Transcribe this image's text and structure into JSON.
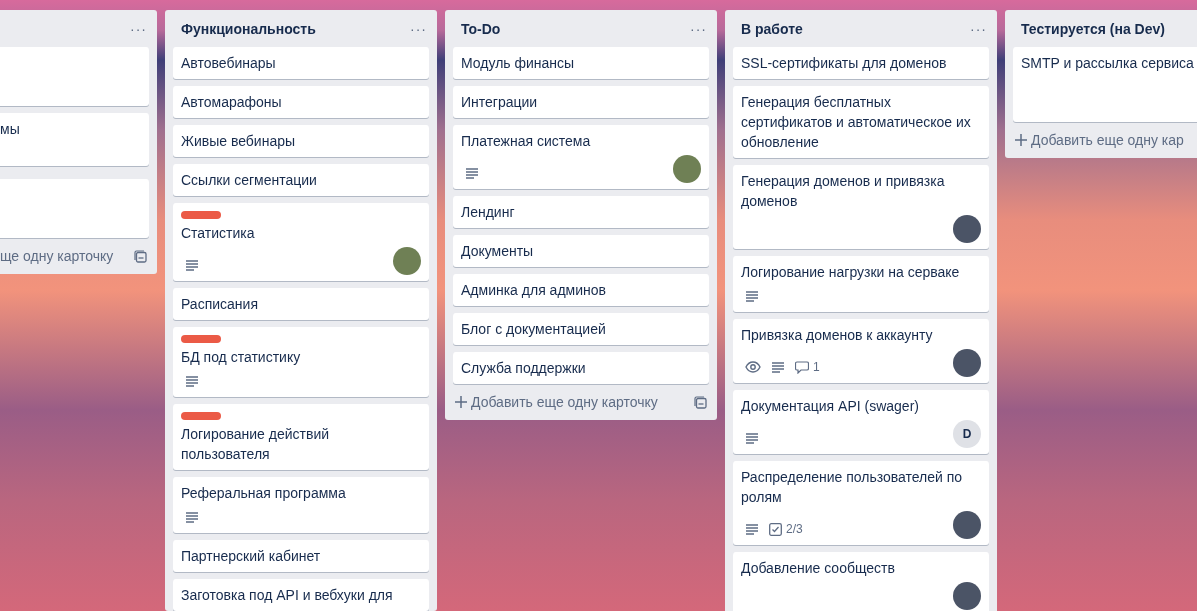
{
  "lists": [
    {
      "kind": "partial-left",
      "menu": "···",
      "cards": [
        {
          "kind": "blank"
        },
        {
          "kind": "task",
          "title": "мы"
        },
        {
          "kind": "blank"
        }
      ],
      "add_card": "ще одну карточку"
    },
    {
      "title": "Функциональность",
      "menu": "···",
      "cards": [
        {
          "title": "Автовебинары"
        },
        {
          "title": "Автомарафоны"
        },
        {
          "title": "Живые вебинары"
        },
        {
          "title": "Ссылки сегментации"
        },
        {
          "labels": [
            {
              "color": "#eb5a46"
            }
          ],
          "title": "Статистика",
          "description": true,
          "member": {
            "kind": "photo",
            "color": "#6f8055"
          }
        },
        {
          "title": "Расписания"
        },
        {
          "labels": [
            {
              "color": "#eb5a46"
            }
          ],
          "title": "БД под статистику",
          "description": true
        },
        {
          "labels": [
            {
              "color": "#eb5a46"
            }
          ],
          "title": "Логирование действий пользователя"
        },
        {
          "title": "Реферальная программа",
          "description": true
        },
        {
          "title": "Партнерский кабинет"
        },
        {
          "title": "Заготовка под API и вебхуки для"
        }
      ]
    },
    {
      "title": "To-Do",
      "menu": "···",
      "cards": [
        {
          "title": "Модуль финансы"
        },
        {
          "title": "Интеграции"
        },
        {
          "title": "Платежная система",
          "description": true,
          "member": {
            "kind": "photo",
            "color": "#6f8055"
          }
        },
        {
          "title": "Лендинг"
        },
        {
          "title": "Документы"
        },
        {
          "title": "Админка для админов"
        },
        {
          "title": "Блог с документацией"
        },
        {
          "title": "Служба поддержки"
        }
      ],
      "add_card": "Добавить еще одну карточку"
    },
    {
      "title": "В работе",
      "menu": "···",
      "cards": [
        {
          "title": "SSL-сертификаты для доменов"
        },
        {
          "title": "Генерация бесплатных сертификатов и автоматическое их обновление"
        },
        {
          "title": "Генерация доменов и привязка доменов",
          "member": {
            "kind": "photo",
            "color": "#4b5466"
          }
        },
        {
          "title": "Логирование нагрузки на серваке",
          "description": true
        },
        {
          "title": "Привязка доменов к аккаунту",
          "watching": true,
          "description": true,
          "comments": "1",
          "member": {
            "kind": "photo",
            "color": "#4b5466"
          }
        },
        {
          "title": "Документация API (swager)",
          "description": true,
          "member": {
            "kind": "initial",
            "text": "D"
          }
        },
        {
          "title": "Распределение пользователей по ролям",
          "description": true,
          "checklist": "2/3",
          "member": {
            "kind": "photo",
            "color": "#4b5466"
          }
        },
        {
          "title": "Добавление сообществ",
          "member": {
            "kind": "photo",
            "color": "#4b5466"
          }
        }
      ]
    },
    {
      "kind": "partial-right",
      "title": "Тестируется (на Dev)",
      "cards": [
        {
          "title": "SMTP и рассылка сервиса"
        }
      ],
      "add_card": "Добавить еще одну кар"
    }
  ]
}
